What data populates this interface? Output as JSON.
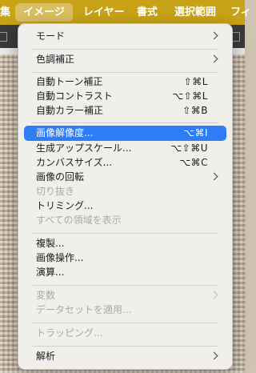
{
  "menubar": {
    "items": [
      {
        "label": "集",
        "active": false
      },
      {
        "label": "イメージ",
        "active": true
      },
      {
        "label": "レイヤー",
        "active": false
      },
      {
        "label": "書式",
        "active": false
      },
      {
        "label": "選択範囲",
        "active": false
      },
      {
        "label": "フィ",
        "active": false
      }
    ]
  },
  "menu": {
    "items": [
      {
        "label": "モード",
        "submenu": true
      },
      {
        "label": "色調補正",
        "submenu": true
      },
      {
        "label": "自動トーン補正",
        "shortcut": "⇧⌘L"
      },
      {
        "label": "自動コントラスト",
        "shortcut": "⌥⇧⌘L"
      },
      {
        "label": "自動カラー補正",
        "shortcut": "⇧⌘B"
      },
      {
        "label": "画像解像度...",
        "shortcut": "⌥⌘I",
        "highlight": true
      },
      {
        "label": "生成アップスケール...",
        "shortcut": "⌥⇧⌘U"
      },
      {
        "label": "カンバスサイズ...",
        "shortcut": "⌥⌘C"
      },
      {
        "label": "画像の回転",
        "submenu": true
      },
      {
        "label": "切り抜き",
        "disabled": true
      },
      {
        "label": "トリミング..."
      },
      {
        "label": "すべての領域を表示",
        "disabled": true
      },
      {
        "label": "複製..."
      },
      {
        "label": "画像操作..."
      },
      {
        "label": "演算..."
      },
      {
        "label": "変数",
        "submenu": true,
        "disabled": true
      },
      {
        "label": "データセットを適用...",
        "disabled": true
      },
      {
        "label": "トラッピング...",
        "disabled": true
      },
      {
        "label": "解析",
        "submenu": true
      }
    ]
  },
  "colors": {
    "menubar_bg": "#c9a317",
    "highlight": "#2f7df5",
    "menu_bg": "#f1efec"
  }
}
